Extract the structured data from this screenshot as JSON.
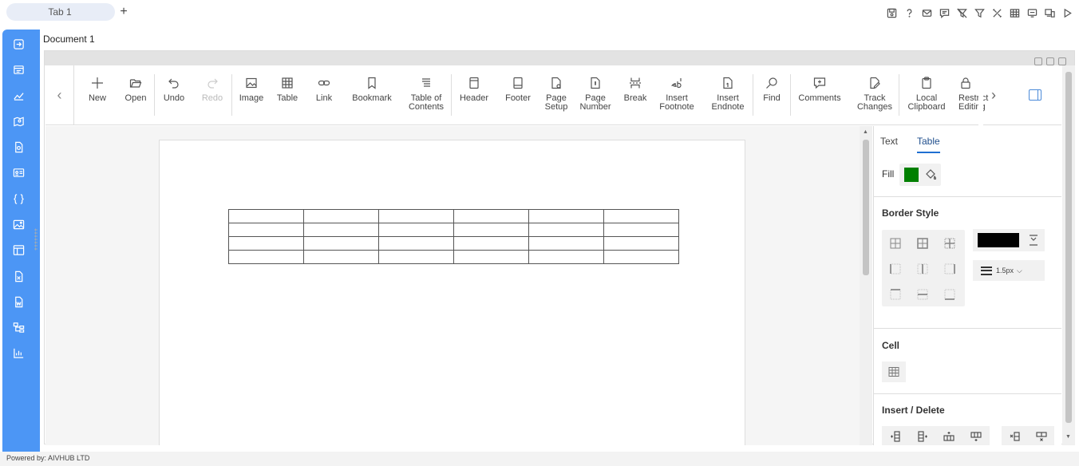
{
  "tabs": [
    {
      "label": "Tab 1"
    }
  ],
  "top_icons": [
    "save-icon",
    "help-icon",
    "mail-icon",
    "comment-icon",
    "filter-clear-icon",
    "filter-icon",
    "tools-icon",
    "table-view-icon",
    "screen-icon",
    "devices-icon",
    "play-icon"
  ],
  "sidebar_icons": [
    "sign-in-icon",
    "list-icon",
    "chart-line-icon",
    "map-icon",
    "document-icon",
    "id-card-icon",
    "code-braces-icon",
    "image-icon",
    "layout-icon",
    "excel-icon",
    "word-icon",
    "hierarchy-icon",
    "bar-chart-icon"
  ],
  "document": {
    "title": "Document 1"
  },
  "toolbar": {
    "new": "New",
    "open": "Open",
    "undo": "Undo",
    "redo": "Redo",
    "image": "Image",
    "table": "Table",
    "link": "Link",
    "bookmark": "Bookmark",
    "toc_1": "Table of",
    "toc_2": "Contents",
    "header": "Header",
    "footer": "Footer",
    "page_setup_1": "Page",
    "page_setup_2": "Setup",
    "page_number_1": "Page",
    "page_number_2": "Number",
    "break": "Break",
    "footnote_1": "Insert",
    "footnote_2": "Footnote",
    "endnote_1": "Insert",
    "endnote_2": "Endnote",
    "find": "Find",
    "comments": "Comments",
    "track_1": "Track",
    "track_2": "Changes",
    "clipboard_1": "Local",
    "clipboard_2": "Clipboard",
    "restrict_1": "Restrict",
    "restrict_2": "Editing"
  },
  "doc_table": {
    "rows": 4,
    "cols": 6
  },
  "panel": {
    "tab_text": "Text",
    "tab_table": "Table",
    "fill_label": "Fill",
    "fill_color": "#008000",
    "border_style_heading": "Border Style",
    "border_color": "#000000",
    "border_width": "1.5px",
    "cell_heading": "Cell",
    "insert_delete_heading": "Insert / Delete"
  },
  "footer": {
    "powered_by": "Powered by: AIVHUB LTD"
  }
}
